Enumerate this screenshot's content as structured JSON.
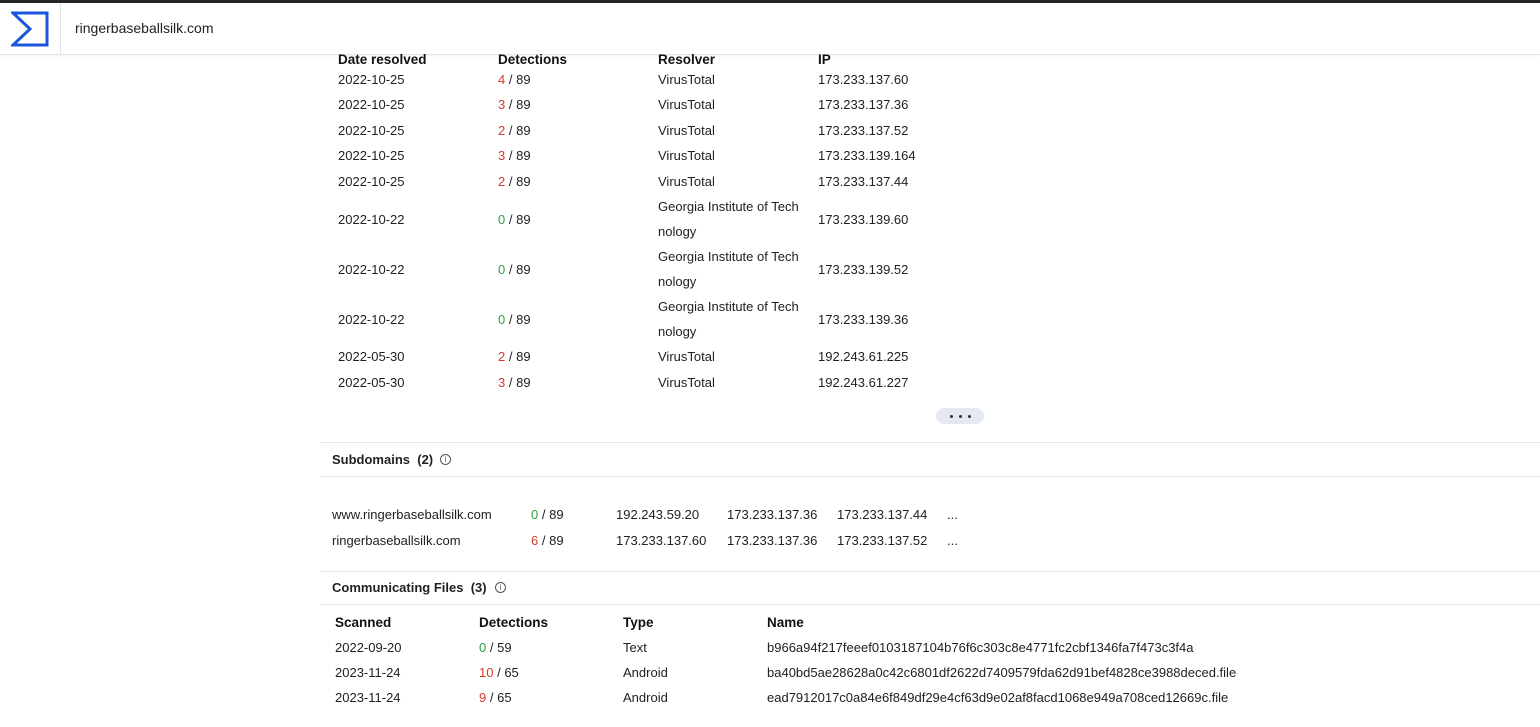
{
  "header": {
    "domain": "ringerbaseballsilk.com",
    "logo_icon": "sigma-logo-icon"
  },
  "resolutions": {
    "columns": [
      "Date resolved",
      "Detections",
      "Resolver",
      "IP"
    ],
    "rows": [
      {
        "date": "2022-10-25",
        "det": "4",
        "total": "/ 89",
        "resolver1": "VirusTotal",
        "resolver2": "",
        "ip": "173.233.137.60",
        "color": "red"
      },
      {
        "date": "2022-10-25",
        "det": "3",
        "total": "/ 89",
        "resolver1": "VirusTotal",
        "resolver2": "",
        "ip": "173.233.137.36",
        "color": "red"
      },
      {
        "date": "2022-10-25",
        "det": "2",
        "total": "/ 89",
        "resolver1": "VirusTotal",
        "resolver2": "",
        "ip": "173.233.137.52",
        "color": "red"
      },
      {
        "date": "2022-10-25",
        "det": "3",
        "total": "/ 89",
        "resolver1": "VirusTotal",
        "resolver2": "",
        "ip": "173.233.139.164",
        "color": "red"
      },
      {
        "date": "2022-10-25",
        "det": "2",
        "total": "/ 89",
        "resolver1": "VirusTotal",
        "resolver2": "",
        "ip": "173.233.137.44",
        "color": "red"
      },
      {
        "date": "2022-10-22",
        "det": "0",
        "total": "/ 89",
        "resolver1": "Georgia Institute of Tech",
        "resolver2": "nology",
        "ip": "173.233.139.60",
        "color": "green"
      },
      {
        "date": "2022-10-22",
        "det": "0",
        "total": "/ 89",
        "resolver1": "Georgia Institute of Tech",
        "resolver2": "nology",
        "ip": "173.233.139.52",
        "color": "green"
      },
      {
        "date": "2022-10-22",
        "det": "0",
        "total": "/ 89",
        "resolver1": "Georgia Institute of Tech",
        "resolver2": "nology",
        "ip": "173.233.139.36",
        "color": "green"
      },
      {
        "date": "2022-05-30",
        "det": "2",
        "total": "/ 89",
        "resolver1": "VirusTotal",
        "resolver2": "",
        "ip": "192.243.61.225",
        "color": "red"
      },
      {
        "date": "2022-05-30",
        "det": "3",
        "total": "/ 89",
        "resolver1": "VirusTotal",
        "resolver2": "",
        "ip": "192.243.61.227",
        "color": "red"
      }
    ]
  },
  "subdomains": {
    "title": "Subdomains",
    "count": "(2)",
    "rows": [
      {
        "name": "www.ringerbaseballsilk.com",
        "det": "0",
        "total": "/ 89",
        "color": "green",
        "ips": [
          "192.243.59.20",
          "173.233.137.36",
          "173.233.137.44"
        ],
        "more": "..."
      },
      {
        "name": "ringerbaseballsilk.com",
        "det": "6",
        "total": "/ 89",
        "color": "red",
        "ips": [
          "173.233.137.60",
          "173.233.137.36",
          "173.233.137.52"
        ],
        "more": "..."
      }
    ]
  },
  "files": {
    "title": "Communicating Files",
    "count": "(3)",
    "columns": [
      "Scanned",
      "Detections",
      "Type",
      "Name"
    ],
    "rows": [
      {
        "date": "2022-09-20",
        "det": "0",
        "total": "/ 59",
        "color": "green",
        "type": "Text",
        "name": "b966a94f217feeef0103187104b76f6c303c8e4771fc2cbf1346fa7f473c3f4a"
      },
      {
        "date": "2023-11-24",
        "det": "10",
        "total": "/ 65",
        "color": "red",
        "type": "Android",
        "name": "ba40bd5ae28628a0c42c6801df2622d7409579fda62d91bef4828ce3988deced.file"
      },
      {
        "date": "2023-11-24",
        "det": "9",
        "total": "/ 65",
        "color": "red",
        "type": "Android",
        "name": "ead7912017c0a84e6f849df29e4cf63d9e02af8facd1068e949a708ced12669c.file"
      }
    ]
  },
  "colors": {
    "red": "#d33a2c",
    "green": "#2ea043",
    "logo": "#1a56db"
  }
}
